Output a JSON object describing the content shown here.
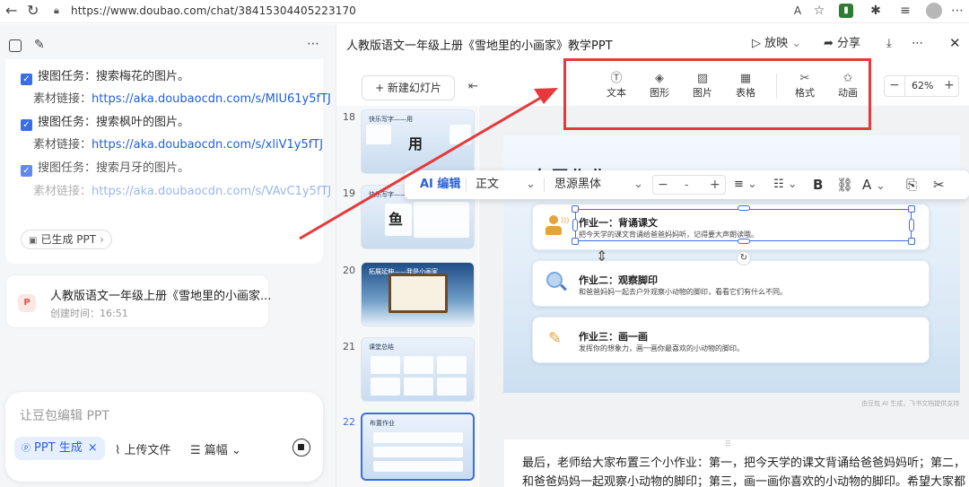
{
  "browser": {
    "url": "https://www.doubao.com/chat/384153044052231​70"
  },
  "chat": {
    "tasks": [
      {
        "task": "搜图任务：搜索梅花的图片。",
        "link_label": "素材链接：",
        "link": "https://aka.doubaocdn.com/s/MlU61y5fTJ"
      },
      {
        "task": "搜图任务：搜索枫叶的图片。",
        "link_label": "素材链接：",
        "link": "https://aka.doubaocdn.com/s/xliV1y5fTJ"
      },
      {
        "task": "搜图任务：搜索月牙的图片。",
        "link_label": "素材链接：",
        "link": "https://aka.doubaocdn.com/s/VAvC1y5fTJ"
      }
    ],
    "generated_pill": "已生成 PPT",
    "file_card": {
      "title": "人教版语文一年级上册《雪地里的小画家...",
      "time": "创建时间：16:51"
    },
    "input": {
      "placeholder": "让豆包编辑 PPT",
      "ppt_chip": "PPT 生成",
      "upload": "上传文件",
      "length": "篇幅"
    }
  },
  "editor": {
    "title": "人教版语文一年级上册《雪地里的小画家》教学PPT",
    "play": "放映",
    "share": "分享",
    "new_slide": "+ 新建幻灯片",
    "tools": [
      {
        "label": "文本",
        "icon": "text-icon"
      },
      {
        "label": "图形",
        "icon": "shape-icon"
      },
      {
        "label": "图片",
        "icon": "image-icon"
      },
      {
        "label": "表格",
        "icon": "table-icon"
      },
      {
        "label": "格式",
        "icon": "format-icon"
      },
      {
        "label": "动画",
        "icon": "animation-icon"
      }
    ],
    "zoom": "62%",
    "thumbnails": [
      {
        "num": "18",
        "title": "快乐写字——用",
        "big": "用"
      },
      {
        "num": "19",
        "title": "快乐写字——鱼",
        "big": "鱼"
      },
      {
        "num": "20",
        "title": "拓展延伸——我是小画家",
        "big": ""
      },
      {
        "num": "21",
        "title": "课堂总结",
        "big": ""
      },
      {
        "num": "22",
        "title": "布置作业",
        "big": ""
      }
    ],
    "format_bar": {
      "ai_edit": "AI 编辑",
      "style": "正文",
      "font": "思源黑体",
      "size": "-",
      "bold": "B",
      "color": "A"
    },
    "slide": {
      "title": "布置作业",
      "cards": [
        {
          "title": "作业一：背诵课文",
          "desc": "把今天学的课文背诵给爸爸妈妈听，记得要大声朗读哦。"
        },
        {
          "title": "作业二：观察脚印",
          "desc": "和爸爸妈妈一起去户外观察小动物的脚印，看看它们有什么不同。"
        },
        {
          "title": "作业三：画一画",
          "desc": "发挥你的想象力，画一画你最喜欢的小动物的脚印。"
        }
      ],
      "watermark": "由豆包 AI 生成，飞书文档提供支持"
    },
    "notes": [
      "最后，老师给大家布置三个小作业：第一，把今天学的课文背诵给爸爸妈妈听；第二，",
      "和爸爸妈妈一起观察小动物的脚印；第三，画一画你喜欢的小动物的脚印。希望大家都"
    ]
  },
  "colors": {
    "accent": "#3a6ee8",
    "annotation": "#e5393b",
    "link": "#1f5fd6"
  }
}
